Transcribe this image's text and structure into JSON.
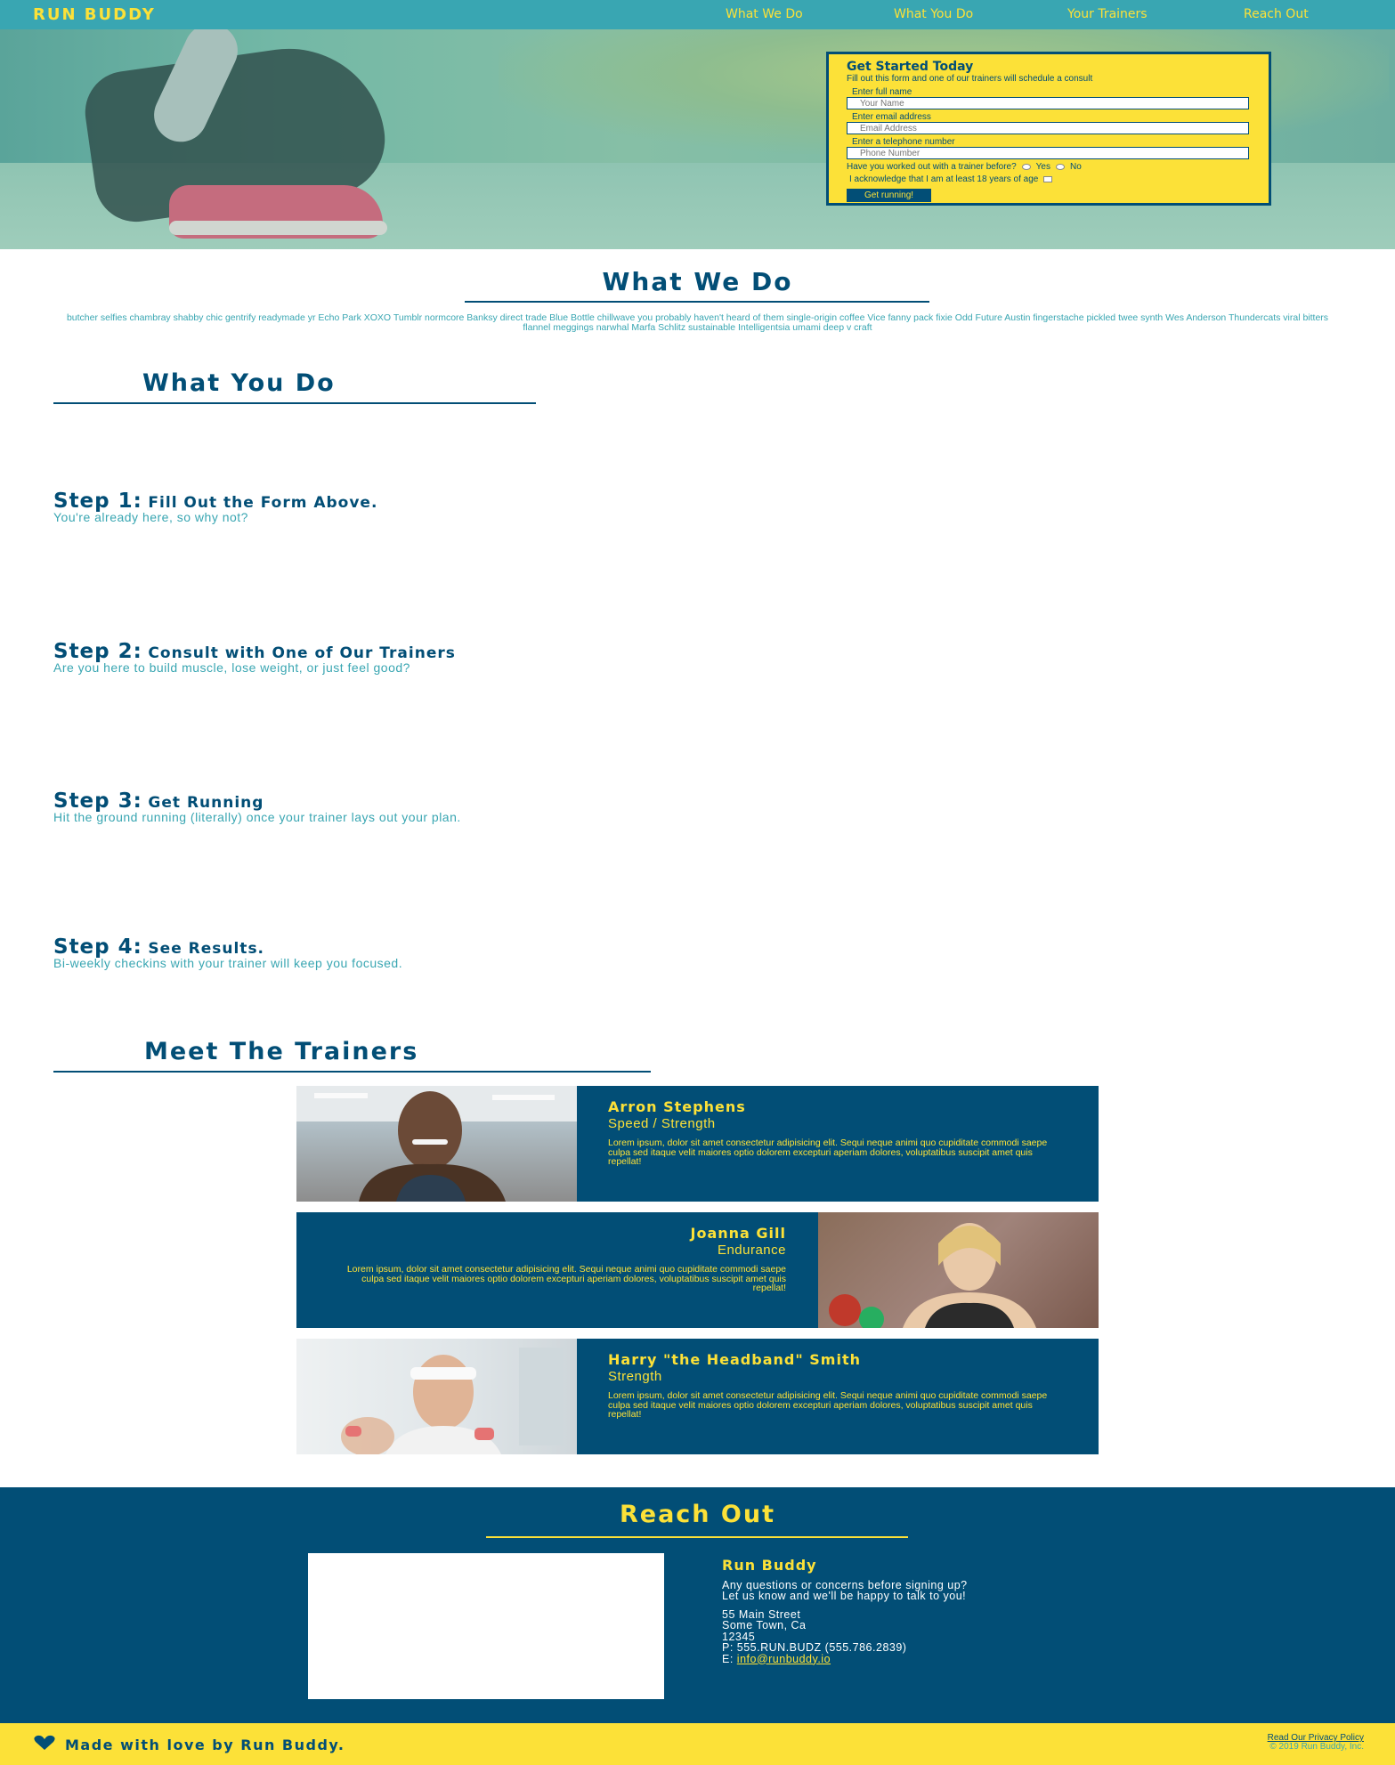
{
  "header": {
    "brand": "RUN BUDDY",
    "nav": [
      "What We Do",
      "What You Do",
      "Your Trainers",
      "Reach Out"
    ]
  },
  "form": {
    "title": "Get Started Today",
    "subtitle": "Fill out this form and one of our trainers will schedule a consult",
    "name_label": "Enter full name",
    "name_placeholder": "Your Name",
    "email_label": "Enter email address",
    "email_placeholder": "Email Address",
    "phone_label": "Enter a telephone number",
    "phone_placeholder": "Phone Number",
    "worked_question": "Have you worked out with a trainer before?",
    "yes": "Yes",
    "no": "No",
    "acknowledge": "I acknowledge that I am at least 18 years of age",
    "submit": "Get running!"
  },
  "what_we_do": {
    "title": "What We Do",
    "text": "butcher selfies chambray shabby chic gentrify readymade yr Echo Park XOXO Tumblr normcore Banksy direct trade Blue Bottle chillwave you probably haven't heard of them single-origin coffee Vice fanny pack fixie Odd Future Austin fingerstache pickled twee synth Wes Anderson Thundercats viral bitters flannel meggings narwhal Marfa Schlitz sustainable Intelligentsia umami deep v craft"
  },
  "what_you_do": {
    "title": "What You Do",
    "steps": [
      {
        "num": "Step 1:",
        "title": "Fill Out the Form Above.",
        "text": "You're already here, so why not?"
      },
      {
        "num": "Step 2:",
        "title": "Consult with One of Our Trainers",
        "text": "Are you here to build muscle, lose weight, or just feel good?"
      },
      {
        "num": "Step 3:",
        "title": "Get Running",
        "text": "Hit the ground running (literally) once your trainer lays out your plan."
      },
      {
        "num": "Step 4:",
        "title": "See Results.",
        "text": "Bi-weekly checkins with your trainer will keep you focused."
      }
    ]
  },
  "trainers": {
    "title": "Meet The Trainers",
    "list": [
      {
        "name": "Arron Stephens",
        "role": "Speed / Strength",
        "bio": "Lorem ipsum, dolor sit amet consectetur adipisicing elit. Sequi neque animi quo cupiditate commodi saepe culpa sed itaque velit maiores optio dolorem excepturi aperiam dolores, voluptatibus suscipit amet quis repellat!"
      },
      {
        "name": "Joanna Gill",
        "role": "Endurance",
        "bio": "Lorem ipsum, dolor sit amet consectetur adipisicing elit. Sequi neque animi quo cupiditate commodi saepe culpa sed itaque velit maiores optio dolorem excepturi aperiam dolores, voluptatibus suscipit amet quis repellat!"
      },
      {
        "name": "Harry \"the Headband\" Smith",
        "role": "Strength",
        "bio": "Lorem ipsum, dolor sit amet consectetur adipisicing elit. Sequi neque animi quo cupiditate commodi saepe culpa sed itaque velit maiores optio dolorem excepturi aperiam dolores, voluptatibus suscipit amet quis repellat!"
      }
    ]
  },
  "reach_out": {
    "title": "Reach Out",
    "name": "Run Buddy",
    "line1": "Any questions or concerns before signing up?",
    "line2": "Let us know and we'll be happy to talk to you!",
    "street": "55 Main Street",
    "city": "Some Town, Ca",
    "zip": "12345",
    "phone": "P: 555.RUN.BUDZ (555.786.2839)",
    "email_prefix": "E:",
    "email": "info@runbuddy.io"
  },
  "footer": {
    "made_with": "Made with love by Run Buddy.",
    "policy": "Read Our Privacy Policy",
    "copyright": "© 2019 Run Buddy, Inc."
  },
  "colors": {
    "primary": "#024e76",
    "secondary": "#39a6b2",
    "accent": "#fce138"
  },
  "icons": {
    "footer": "heart-icon"
  }
}
